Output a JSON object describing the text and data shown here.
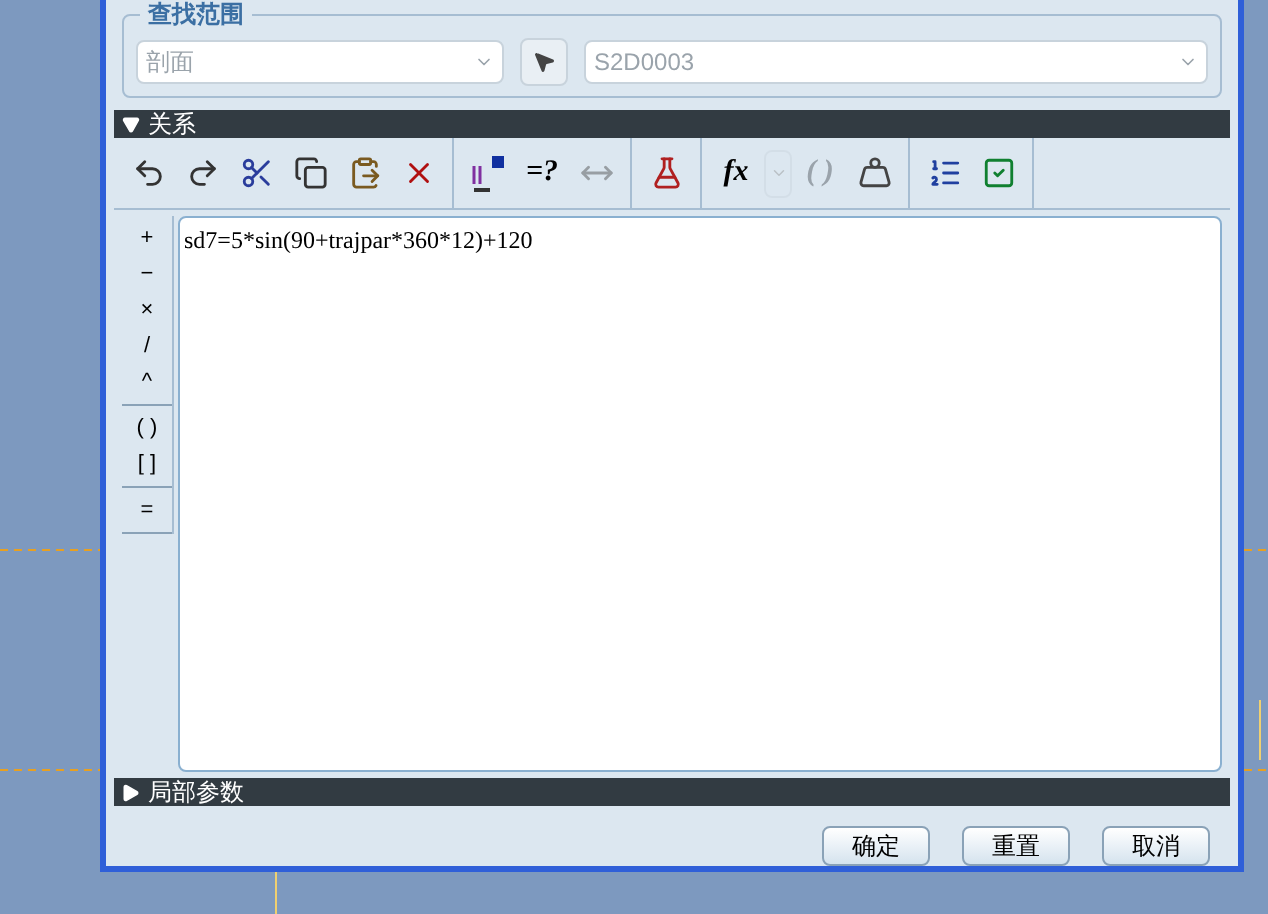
{
  "search_scope": {
    "title": "查找范围",
    "type_combo": {
      "value": "剖面",
      "disabled": true
    },
    "item_combo": {
      "value": "S2D0003",
      "disabled": true
    }
  },
  "relations_section": {
    "title": "关系",
    "expanded": true
  },
  "toolbar": [
    [
      {
        "kind": "undo",
        "disabled": false
      },
      {
        "kind": "redo",
        "disabled": false
      },
      {
        "kind": "cut",
        "disabled": false
      },
      {
        "kind": "copy",
        "disabled": false
      },
      {
        "kind": "paste",
        "disabled": false
      },
      {
        "kind": "delete",
        "disabled": false
      }
    ],
    [
      {
        "kind": "dims",
        "disabled": false
      },
      {
        "kind": "text",
        "label": "=?",
        "disabled": false
      },
      {
        "kind": "measure",
        "disabled": true
      }
    ],
    [
      {
        "kind": "verify",
        "disabled": false
      }
    ],
    [
      {
        "kind": "text",
        "label": "fx",
        "disabled": false
      },
      {
        "kind": "dropdown",
        "disabled": true
      },
      {
        "kind": "text",
        "label": "( )",
        "disabled": true
      },
      {
        "kind": "weight",
        "disabled": false
      }
    ],
    [
      {
        "kind": "sort",
        "disabled": false
      },
      {
        "kind": "check",
        "disabled": false
      }
    ]
  ],
  "operators": [
    [
      "+",
      "−",
      "×",
      "/",
      "^"
    ],
    [
      "( )",
      "[ ]"
    ],
    [
      "="
    ]
  ],
  "editor": {
    "value": "sd7=5*sin(90+trajpar*360*12)+120"
  },
  "local_params_section": {
    "title": "局部参数",
    "expanded": false
  },
  "buttons": [
    "确定",
    "重置",
    "取消"
  ]
}
